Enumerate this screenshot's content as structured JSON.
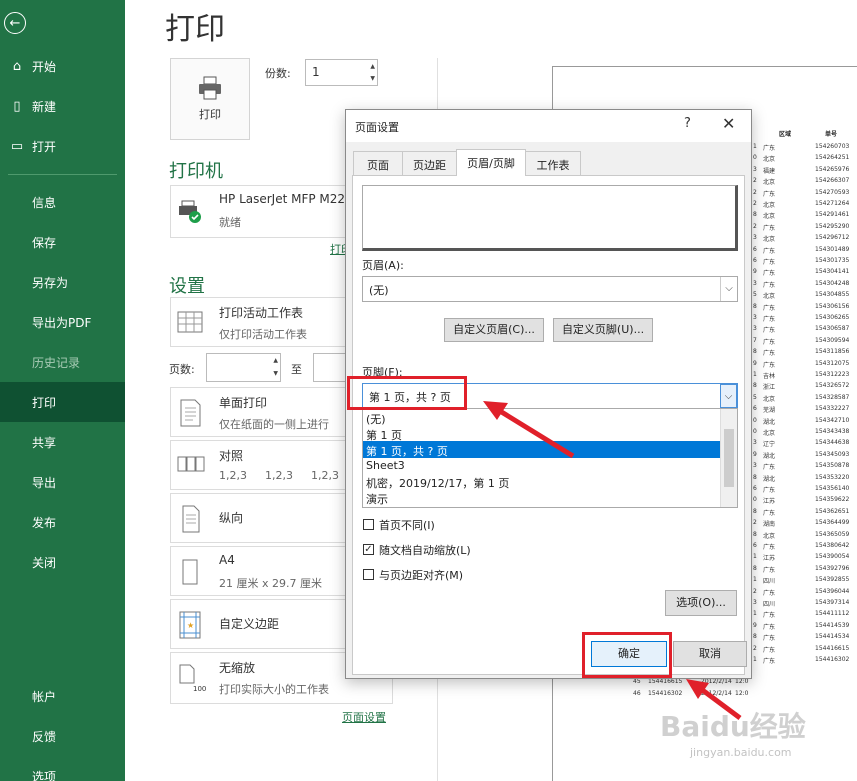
{
  "sidebar": {
    "back_icon": "arrow-left-icon",
    "top_items": [
      {
        "icon": "home-icon",
        "label": "开始"
      },
      {
        "icon": "new-doc-icon",
        "label": "新建"
      },
      {
        "icon": "folder-open-icon",
        "label": "打开"
      }
    ],
    "items": [
      "信息",
      "保存",
      "另存为",
      "导出为PDF",
      "历史记录",
      "打印",
      "共享",
      "导出",
      "发布",
      "关闭"
    ],
    "bottom_items": [
      "帐户",
      "反馈",
      "选项"
    ]
  },
  "main": {
    "title": "打印",
    "print_button": "打印",
    "copies_label": "份数:",
    "copies_value": "1",
    "printer_section": "打印机",
    "printer_name": "HP LaserJet MFP M22",
    "printer_status": "就绪",
    "printer_props_link": "打印",
    "settings_section": "设置",
    "scope_title": "打印活动工作表",
    "scope_desc": "仅打印活动工作表",
    "pages_label": "页数:",
    "to_label": "至",
    "sides_title": "单面打印",
    "sides_desc": "仅在纸面的一侧上进行",
    "collate_title": "对照",
    "collate_desc": [
      "1,2,3",
      "1,2,3",
      "1,2,3"
    ],
    "orientation": "纵向",
    "paper_title": "A4",
    "paper_desc": "21 厘米 x 29.7 厘米",
    "margins": "自定义边距",
    "scaling_title": "无缩放",
    "scaling_desc": "打印实际大小的工作表",
    "page_setup_link": "页面设置"
  },
  "preview": {
    "headers": [
      "区域",
      "单号"
    ],
    "rows": [
      [
        "1",
        "广东",
        "154260703"
      ],
      [
        "0",
        "北京",
        "154264251"
      ],
      [
        "3",
        "福建",
        "154265976"
      ],
      [
        "2",
        "北京",
        "154266307"
      ],
      [
        "2",
        "广东",
        "154270593"
      ],
      [
        "2",
        "北京",
        "154271264"
      ],
      [
        "8",
        "北京",
        "154291461"
      ],
      [
        "2",
        "广东",
        "154295290"
      ],
      [
        "3",
        "北京",
        "154296712"
      ],
      [
        "6",
        "广东",
        "154301489"
      ],
      [
        "6",
        "广东",
        "154301735"
      ],
      [
        "9",
        "广东",
        "154304141"
      ],
      [
        "3",
        "广东",
        "154304248"
      ],
      [
        "5",
        "北京",
        "154304855"
      ],
      [
        "8",
        "广东",
        "154306156"
      ],
      [
        "3",
        "广东",
        "154306265"
      ],
      [
        "3",
        "广东",
        "154306587"
      ],
      [
        "7",
        "广东",
        "154309594"
      ],
      [
        "8",
        "广东",
        "154311856"
      ],
      [
        "9",
        "广东",
        "154312075"
      ],
      [
        "1",
        "吉林",
        "154312223"
      ],
      [
        "8",
        "浙江",
        "154326572"
      ],
      [
        "5",
        "北京",
        "154328587"
      ],
      [
        "6",
        "芜湖",
        "154332227"
      ],
      [
        "0",
        "湖北",
        "154342710"
      ],
      [
        "0",
        "北京",
        "154343438"
      ],
      [
        "3",
        "辽宁",
        "154344638"
      ],
      [
        "9",
        "湖北",
        "154345093"
      ],
      [
        "3",
        "广东",
        "154350878"
      ],
      [
        "8",
        "湖北",
        "154353220"
      ],
      [
        "6",
        "广东",
        "154356140"
      ],
      [
        "0",
        "江苏",
        "154359622"
      ],
      [
        "8",
        "广东",
        "154362651"
      ],
      [
        "2",
        "湖南",
        "154364499"
      ],
      [
        "8",
        "北京",
        "154365059"
      ],
      [
        "6",
        "广东",
        "154380642"
      ],
      [
        "1",
        "江苏",
        "154390054"
      ],
      [
        "8",
        "广东",
        "154392796"
      ],
      [
        "1",
        "四川",
        "154392855"
      ],
      [
        "2",
        "广东",
        "154396044"
      ],
      [
        "3",
        "四川",
        "154397314"
      ],
      [
        "1",
        "广东",
        "154411112"
      ],
      [
        "9",
        "广东",
        "154414539"
      ],
      [
        "8",
        "广东",
        "154414534"
      ],
      [
        "2",
        "广东",
        "154416615"
      ],
      [
        "1",
        "广东",
        "154416302"
      ]
    ],
    "tail_rows": [
      [
        "45",
        "154416615",
        "2012/2/14",
        "12:0"
      ],
      [
        "46",
        "154416302",
        "2012/2/14",
        "12:0"
      ]
    ]
  },
  "dialog": {
    "title": "页面设置",
    "help": "?",
    "close": "✕",
    "tabs": [
      "页面",
      "页边距",
      "页眉/页脚",
      "工作表"
    ],
    "selected_tab": 2,
    "header_label": "页眉(A):",
    "header_value": "(无)",
    "custom_header_btn": "自定义页眉(C)...",
    "custom_footer_btn": "自定义页脚(U)...",
    "footer_label": "页脚(F):",
    "footer_value": "第 1 页，共 ? 页",
    "footer_options": [
      "(无)",
      "第 1 页",
      "第 1 页，共 ? 页",
      "Sheet3",
      " 机密，2019/12/17，第 1 页",
      "演示"
    ],
    "footer_selected": 2,
    "checkboxes": [
      {
        "label": "首页不同(I)",
        "checked": false
      },
      {
        "label": "随文档自动缩放(L)",
        "checked": true
      },
      {
        "label": "与页边距对齐(M)",
        "checked": false
      }
    ],
    "options_btn": "选项(O)...",
    "ok_btn": "确定",
    "cancel_btn": "取消"
  },
  "watermark": {
    "text": "Baidu经验",
    "url": "jingyan.baidu.com"
  },
  "colors": {
    "brand": "#217346",
    "highlight": "#e0202a",
    "selection": "#0078d7"
  }
}
